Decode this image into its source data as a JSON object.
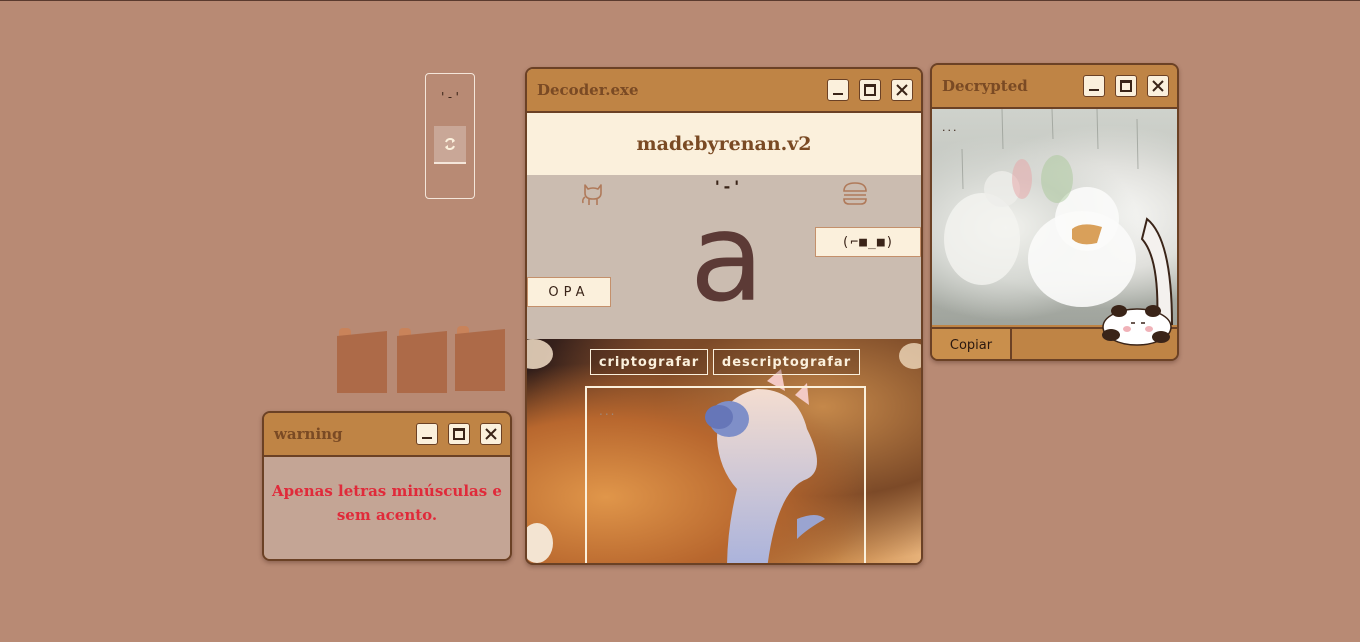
{
  "widget": {
    "face": "'-'",
    "swap_icon": "refresh-icon"
  },
  "warning": {
    "title": "warning",
    "message": "Apenas letras minúsculas e sem acento."
  },
  "decoder": {
    "title": "Decoder.exe",
    "brand": "madebyrenan.v2",
    "face": "'-'",
    "big_letter": "a",
    "kaomoji": "(⌐■_■)",
    "opa_label": "OPA",
    "encrypt_label": "criptografar",
    "decrypt_label": "descriptografar",
    "input_placeholder": "...",
    "icons": [
      "github-cat-icon",
      "burger-icon"
    ]
  },
  "decrypted": {
    "title": "Decrypted",
    "output": "...",
    "copy_label": "Copiar"
  },
  "colors": {
    "desktop": "#b88a74",
    "titlebar": "#bf8445",
    "warning_text": "#e02a3a",
    "brand_text": "#7a4a24"
  }
}
